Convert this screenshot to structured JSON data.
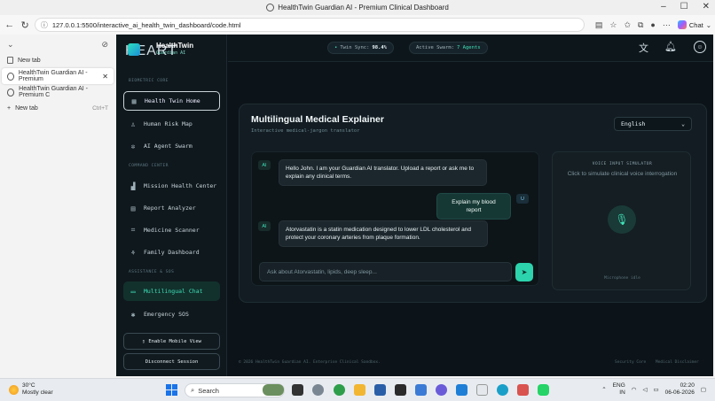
{
  "browser": {
    "window_title": "HealthTwin Guardian AI - Premium Clinical Dashboard",
    "url": "127.0.0.1:5500/interactive_ai_health_twin_dashboard/code.html",
    "chat_label": "Chat",
    "tabs": [
      {
        "label": "New tab"
      },
      {
        "label": "HealthTwin Guardian AI - Premium"
      },
      {
        "label": "HealthTwin Guardian AI - Premium C"
      },
      {
        "label": "New tab",
        "shortcut": "Ctrl+T"
      }
    ]
  },
  "app": {
    "logo_ghost": "HEART",
    "brand": "HealthTwin",
    "brand_sub": "Guardian AI",
    "sections": {
      "biometric": "BIOMETRIC CORE",
      "command": "COMMAND CENTER",
      "assistance": "ASSISTANCE & SOS"
    },
    "nav": {
      "health_twin_home": "Health Twin Home",
      "human_risk_map": "Human Risk Map",
      "ai_agent_swarm": "AI Agent Swarm",
      "mission_health_center": "Mission Health Center",
      "report_analyzer": "Report Analyzer",
      "medicine_scanner": "Medicine Scanner",
      "family_dashboard": "Family Dashboard",
      "multilingual_chat": "Multilingual Chat",
      "emergency_sos": "Emergency SOS"
    },
    "enable_mobile": "Enable Mobile View",
    "disconnect": "Disconnect Session",
    "topbar": {
      "twin_sync_label": "Twin Sync:",
      "twin_sync_value": "98.4%",
      "swarm_label": "Active Swarm:",
      "swarm_value": "7 Agents"
    },
    "card": {
      "title": "Multilingual Medical Explainer",
      "subtitle": "Interactive medical-jargon translator",
      "language": "English",
      "messages": [
        {
          "role": "AI",
          "text": "Hello John. I am your Guardian AI translator. Upload a report or ask me to explain any clinical terms."
        },
        {
          "role": "U",
          "text": "Explain my blood report"
        },
        {
          "role": "AI",
          "text": "Atorvastatin is a statin medication designed to lower LDL cholesterol and protect your coronary arteries from plaque formation."
        }
      ],
      "input_placeholder": "Ask about Atorvastatin, lipids, deep sleep..."
    },
    "voice": {
      "title": "VOICE INPUT SIMULATOR",
      "subtitle": "Click to simulate clinical voice interrogation",
      "status": "Microphone idle"
    },
    "footer": {
      "copyright": "© 2026 HealthTwin Guardian AI. Enterprise Clinical Sandbox.",
      "security": "Security Core",
      "disclaimer": "Medical Disclaimer"
    }
  },
  "taskbar": {
    "temp": "30°C",
    "weather": "Mostly clear",
    "search": "Search",
    "lang1": "ENG",
    "lang2": "IN",
    "time": "02:20",
    "date": "06-06-2026"
  }
}
